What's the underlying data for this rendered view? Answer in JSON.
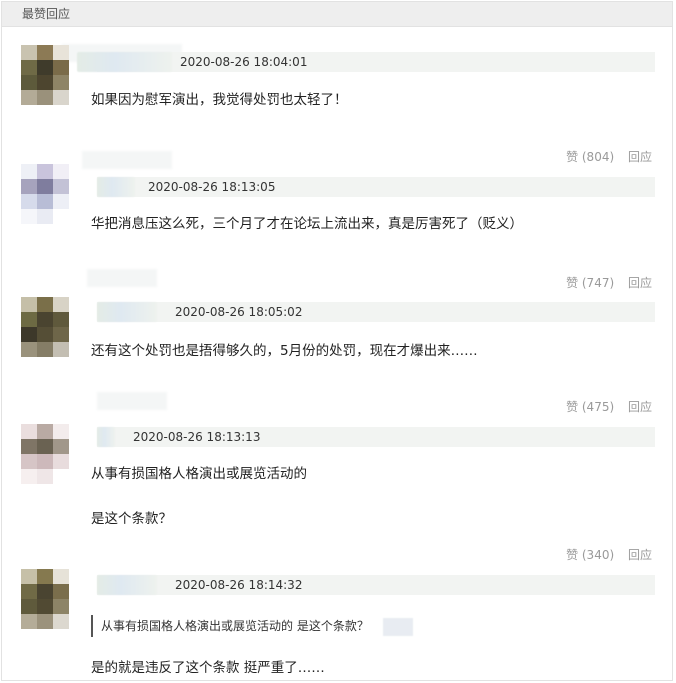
{
  "panel": {
    "title": "最赞回应"
  },
  "comments": [
    {
      "time": "2020-08-26 18:04:01",
      "lines": [
        "如果因为慰军演出，我觉得处罚也太轻了！"
      ],
      "likes": "赞 (804)",
      "reply": "回应"
    },
    {
      "time": "2020-08-26 18:13:05",
      "lines": [
        "华把消息压这么死，三个月了才在论坛上流出来，真是厉害死了（贬义）"
      ],
      "likes": "赞 (747)",
      "reply": "回应"
    },
    {
      "time": "2020-08-26 18:05:02",
      "lines": [
        "还有这个处罚也是捂得够久的，5月份的处罚，现在才爆出来……"
      ],
      "likes": "赞 (475)",
      "reply": "回应"
    },
    {
      "time": "2020-08-26 18:13:13",
      "lines": [
        "从事有损国格人格演出或展览活动的",
        "是这个条款？"
      ],
      "likes": "赞 (340)",
      "reply": "回应"
    },
    {
      "time": "2020-08-26 18:14:32",
      "quote": "从事有损国格人格演出或展览活动的 是这个条款？",
      "lines": [
        "是的就是违反了这个条款 挺严重了……"
      ]
    }
  ]
}
